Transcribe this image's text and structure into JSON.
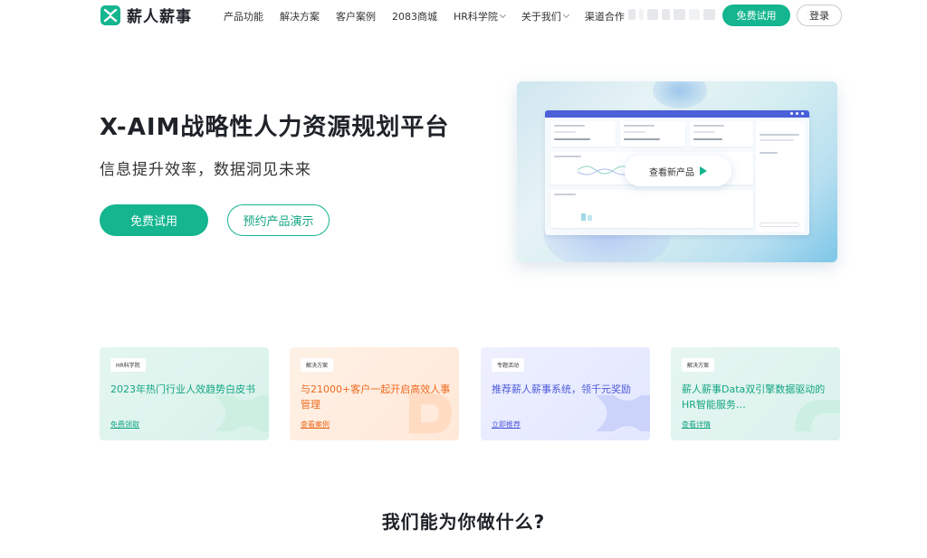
{
  "brand": {
    "name": "薪人薪事",
    "accent": "#14b58f"
  },
  "nav": {
    "items": [
      {
        "label": "产品功能",
        "dropdown": false
      },
      {
        "label": "解决方案",
        "dropdown": false
      },
      {
        "label": "客户案例",
        "dropdown": false
      },
      {
        "label": "2083商城",
        "dropdown": false
      },
      {
        "label": "HR科学院",
        "dropdown": true
      },
      {
        "label": "关于我们",
        "dropdown": true
      },
      {
        "label": "渠道合作",
        "dropdown": false
      }
    ],
    "trial_label": "免费试用",
    "login_label": "登录"
  },
  "hero": {
    "title": "X-AIM战略性人力资源规划平台",
    "subtitle": "信息提升效率，数据洞见未来",
    "trial_label": "免费试用",
    "demo_label": "预约产品演示",
    "video_label": "查看新产品"
  },
  "cards": [
    {
      "tag": "HR科学院",
      "title": "2023年热门行业人效趋势白皮书",
      "link": "免费领取",
      "color": "#14a584"
    },
    {
      "tag": "解决方案",
      "title": "与21000+客户一起开启高效人事管理",
      "link": "查看案例",
      "color": "#ee6a1d"
    },
    {
      "tag": "专题活动",
      "title": "推荐薪人薪事系统，领千元奖励",
      "link": "立即推荐",
      "color": "#4d5ad8"
    },
    {
      "tag": "解决方案",
      "title": "薪人薪事Data双引擎数据驱动的HR智能服务…",
      "link": "查看详情",
      "color": "#14a584"
    }
  ],
  "section": {
    "title": "我们能为你做什么?"
  }
}
